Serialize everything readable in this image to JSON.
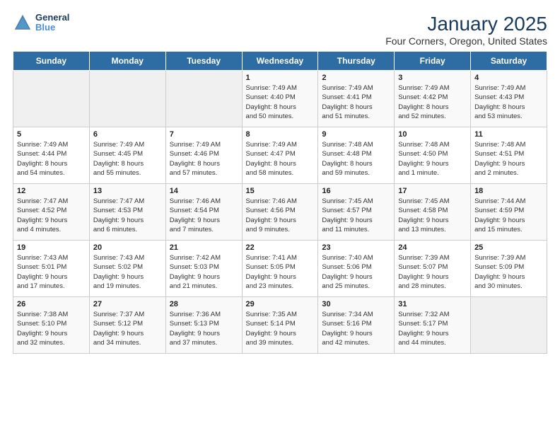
{
  "header": {
    "logo_line1": "General",
    "logo_line2": "Blue",
    "title": "January 2025",
    "subtitle": "Four Corners, Oregon, United States"
  },
  "days_of_week": [
    "Sunday",
    "Monday",
    "Tuesday",
    "Wednesday",
    "Thursday",
    "Friday",
    "Saturday"
  ],
  "weeks": [
    [
      {
        "num": "",
        "info": ""
      },
      {
        "num": "",
        "info": ""
      },
      {
        "num": "",
        "info": ""
      },
      {
        "num": "1",
        "info": "Sunrise: 7:49 AM\nSunset: 4:40 PM\nDaylight: 8 hours\nand 50 minutes."
      },
      {
        "num": "2",
        "info": "Sunrise: 7:49 AM\nSunset: 4:41 PM\nDaylight: 8 hours\nand 51 minutes."
      },
      {
        "num": "3",
        "info": "Sunrise: 7:49 AM\nSunset: 4:42 PM\nDaylight: 8 hours\nand 52 minutes."
      },
      {
        "num": "4",
        "info": "Sunrise: 7:49 AM\nSunset: 4:43 PM\nDaylight: 8 hours\nand 53 minutes."
      }
    ],
    [
      {
        "num": "5",
        "info": "Sunrise: 7:49 AM\nSunset: 4:44 PM\nDaylight: 8 hours\nand 54 minutes."
      },
      {
        "num": "6",
        "info": "Sunrise: 7:49 AM\nSunset: 4:45 PM\nDaylight: 8 hours\nand 55 minutes."
      },
      {
        "num": "7",
        "info": "Sunrise: 7:49 AM\nSunset: 4:46 PM\nDaylight: 8 hours\nand 57 minutes."
      },
      {
        "num": "8",
        "info": "Sunrise: 7:49 AM\nSunset: 4:47 PM\nDaylight: 8 hours\nand 58 minutes."
      },
      {
        "num": "9",
        "info": "Sunrise: 7:48 AM\nSunset: 4:48 PM\nDaylight: 8 hours\nand 59 minutes."
      },
      {
        "num": "10",
        "info": "Sunrise: 7:48 AM\nSunset: 4:50 PM\nDaylight: 9 hours\nand 1 minute."
      },
      {
        "num": "11",
        "info": "Sunrise: 7:48 AM\nSunset: 4:51 PM\nDaylight: 9 hours\nand 2 minutes."
      }
    ],
    [
      {
        "num": "12",
        "info": "Sunrise: 7:47 AM\nSunset: 4:52 PM\nDaylight: 9 hours\nand 4 minutes."
      },
      {
        "num": "13",
        "info": "Sunrise: 7:47 AM\nSunset: 4:53 PM\nDaylight: 9 hours\nand 6 minutes."
      },
      {
        "num": "14",
        "info": "Sunrise: 7:46 AM\nSunset: 4:54 PM\nDaylight: 9 hours\nand 7 minutes."
      },
      {
        "num": "15",
        "info": "Sunrise: 7:46 AM\nSunset: 4:56 PM\nDaylight: 9 hours\nand 9 minutes."
      },
      {
        "num": "16",
        "info": "Sunrise: 7:45 AM\nSunset: 4:57 PM\nDaylight: 9 hours\nand 11 minutes."
      },
      {
        "num": "17",
        "info": "Sunrise: 7:45 AM\nSunset: 4:58 PM\nDaylight: 9 hours\nand 13 minutes."
      },
      {
        "num": "18",
        "info": "Sunrise: 7:44 AM\nSunset: 4:59 PM\nDaylight: 9 hours\nand 15 minutes."
      }
    ],
    [
      {
        "num": "19",
        "info": "Sunrise: 7:43 AM\nSunset: 5:01 PM\nDaylight: 9 hours\nand 17 minutes."
      },
      {
        "num": "20",
        "info": "Sunrise: 7:43 AM\nSunset: 5:02 PM\nDaylight: 9 hours\nand 19 minutes."
      },
      {
        "num": "21",
        "info": "Sunrise: 7:42 AM\nSunset: 5:03 PM\nDaylight: 9 hours\nand 21 minutes."
      },
      {
        "num": "22",
        "info": "Sunrise: 7:41 AM\nSunset: 5:05 PM\nDaylight: 9 hours\nand 23 minutes."
      },
      {
        "num": "23",
        "info": "Sunrise: 7:40 AM\nSunset: 5:06 PM\nDaylight: 9 hours\nand 25 minutes."
      },
      {
        "num": "24",
        "info": "Sunrise: 7:39 AM\nSunset: 5:07 PM\nDaylight: 9 hours\nand 28 minutes."
      },
      {
        "num": "25",
        "info": "Sunrise: 7:39 AM\nSunset: 5:09 PM\nDaylight: 9 hours\nand 30 minutes."
      }
    ],
    [
      {
        "num": "26",
        "info": "Sunrise: 7:38 AM\nSunset: 5:10 PM\nDaylight: 9 hours\nand 32 minutes."
      },
      {
        "num": "27",
        "info": "Sunrise: 7:37 AM\nSunset: 5:12 PM\nDaylight: 9 hours\nand 34 minutes."
      },
      {
        "num": "28",
        "info": "Sunrise: 7:36 AM\nSunset: 5:13 PM\nDaylight: 9 hours\nand 37 minutes."
      },
      {
        "num": "29",
        "info": "Sunrise: 7:35 AM\nSunset: 5:14 PM\nDaylight: 9 hours\nand 39 minutes."
      },
      {
        "num": "30",
        "info": "Sunrise: 7:34 AM\nSunset: 5:16 PM\nDaylight: 9 hours\nand 42 minutes."
      },
      {
        "num": "31",
        "info": "Sunrise: 7:32 AM\nSunset: 5:17 PM\nDaylight: 9 hours\nand 44 minutes."
      },
      {
        "num": "",
        "info": ""
      }
    ]
  ]
}
